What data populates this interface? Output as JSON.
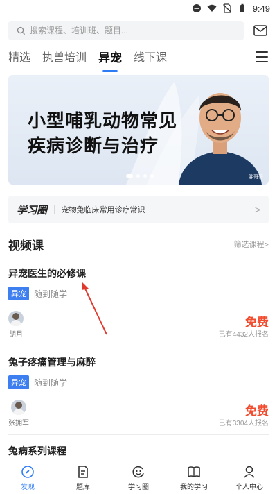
{
  "status_bar": {
    "time": "9:49"
  },
  "search": {
    "placeholder": "搜索课程、培训班、题目..."
  },
  "tabs": [
    {
      "label": "精选"
    },
    {
      "label": "执兽培训"
    },
    {
      "label": "异宠"
    },
    {
      "label": "线下课"
    }
  ],
  "banner": {
    "line1": "小型哺乳动物常见",
    "line2": "疾病诊断与治疗",
    "badge": "胖哥哥"
  },
  "study_circle": {
    "logo": "学习圈",
    "text": "宠物兔临床常用诊疗常识",
    "arrow": ">"
  },
  "video_section": {
    "title": "视频课",
    "filter": "筛选课程>"
  },
  "courses": [
    {
      "title": "异宠医生的必修课",
      "tag": "异宠",
      "mode": "随到随学",
      "teacher": "胡月",
      "price": "免费",
      "enrolled": "已有4432人报名"
    },
    {
      "title": "兔子疼痛管理与麻醉",
      "tag": "异宠",
      "mode": "随到随学",
      "teacher": "张拥军",
      "price": "免费",
      "enrolled": "已有3304人报名"
    },
    {
      "title": "兔病系列课程"
    }
  ],
  "bottom_nav": [
    {
      "label": "发现",
      "icon": "compass-icon"
    },
    {
      "label": "题库",
      "icon": "question-bank-icon"
    },
    {
      "label": "学习圈",
      "icon": "study-circle-icon"
    },
    {
      "label": "我的学习",
      "icon": "book-icon"
    },
    {
      "label": "个人中心",
      "icon": "profile-icon"
    }
  ],
  "colors": {
    "accent": "#2e7bf6",
    "price": "#f24b2e",
    "tag": "#3d7ef0",
    "annotation_arrow": "#e03a2e"
  }
}
